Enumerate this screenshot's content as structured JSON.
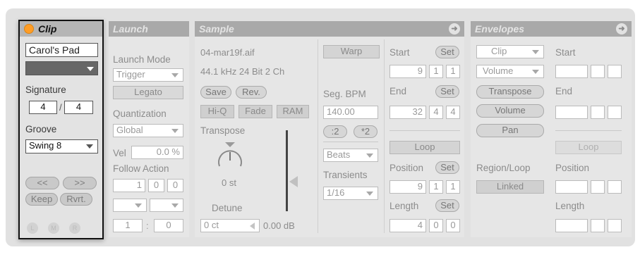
{
  "clip": {
    "title": "Clip",
    "name": "Carol's Pad",
    "signature_label": "Signature",
    "sig_num": "4",
    "sig_den": "4",
    "groove_label": "Groove",
    "groove_value": "Swing 8",
    "nudge_back": "<<",
    "nudge_fwd": ">>",
    "keep": "Keep",
    "revert": "Rvrt.",
    "lmr": [
      "L",
      "M",
      "R"
    ],
    "accent": "#ff9d26"
  },
  "launch": {
    "title": "Launch",
    "mode_label": "Launch Mode",
    "mode_value": "Trigger",
    "legato": "Legato",
    "quant_label": "Quantization",
    "quant_value": "Global",
    "vel_label": "Vel",
    "vel_value": "0.0 %",
    "follow_label": "Follow Action",
    "follow_time": [
      "1",
      "0",
      "0"
    ],
    "chance": [
      "1",
      "0"
    ]
  },
  "sample": {
    "title": "Sample",
    "file": "04-mar19f.aif",
    "info": "44.1 kHz 24 Bit 2 Ch",
    "save": "Save",
    "rev": "Rev.",
    "hiq": "Hi-Q",
    "fade": "Fade",
    "ram": "RAM",
    "transpose_label": "Transpose",
    "transpose_value": "0 st",
    "detune_label": "Detune",
    "detune_value": "0 ct",
    "gain_value": "0.00 dB",
    "warp": "Warp",
    "seg_label": "Seg. BPM",
    "seg_value": "140.00",
    "half": ":2",
    "double": "*2",
    "warp_mode": "Beats",
    "transients_label": "Transients",
    "transients_value": "1/16",
    "start_label": "Start",
    "set": "Set",
    "start": [
      "9",
      "1",
      "1"
    ],
    "end_label": "End",
    "end": [
      "32",
      "4",
      "4"
    ],
    "loop": "Loop",
    "position_label": "Position",
    "position": [
      "9",
      "1",
      "1"
    ],
    "length_label": "Length",
    "length": [
      "4",
      "0",
      "0"
    ]
  },
  "envelopes": {
    "title": "Envelopes",
    "device": "Clip",
    "control": "Volume",
    "transpose": "Transpose",
    "volume": "Volume",
    "pan": "Pan",
    "region_label": "Region/Loop",
    "linked": "Linked",
    "start_label": "Start",
    "end_label": "End",
    "loop": "Loop",
    "position_label": "Position",
    "length_label": "Length"
  }
}
